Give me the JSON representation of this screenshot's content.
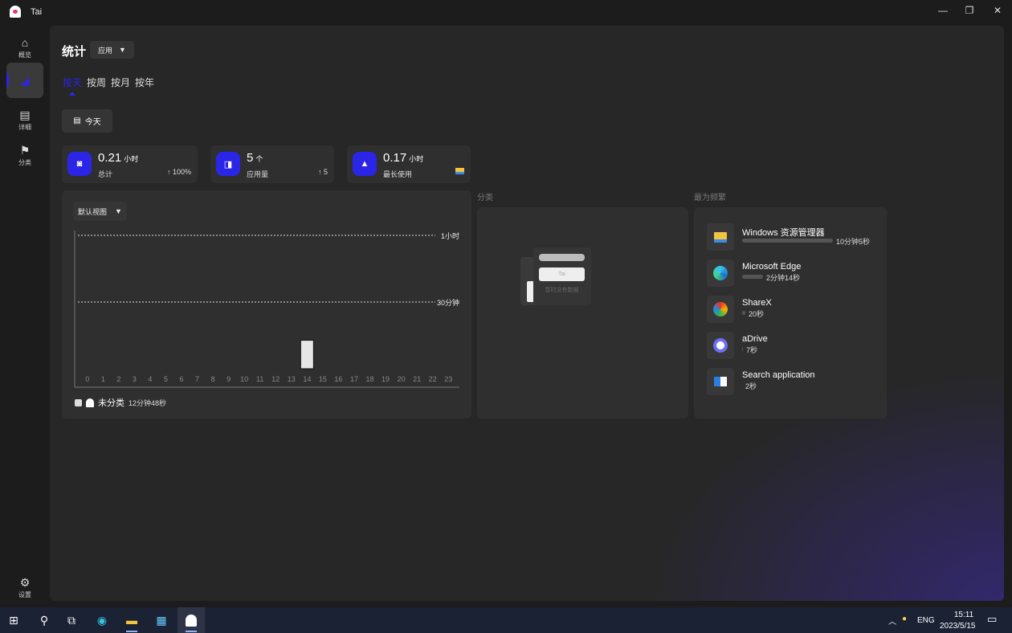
{
  "window": {
    "title": "Tai",
    "controls": [
      "—",
      "❐",
      "✕"
    ]
  },
  "sidebar": {
    "items": [
      {
        "label": "概览",
        "icon": "⌂"
      },
      {
        "label": "",
        "icon": "◢"
      },
      {
        "label": "详细",
        "icon": "▤"
      },
      {
        "label": "分类",
        "icon": "⚑"
      }
    ],
    "settings": {
      "label": "设置",
      "icon": "⚙"
    }
  },
  "header": {
    "title": "统计",
    "filter": "应用"
  },
  "tabs": [
    "按天",
    "按周",
    "按月",
    "按年"
  ],
  "date_button": "今天",
  "stats": [
    {
      "value": "0.21",
      "unit": "小时",
      "label": "总计",
      "change": "↑ 100%"
    },
    {
      "value": "5",
      "unit": "个",
      "label": "应用量",
      "change": "↑ 5"
    },
    {
      "value": "0.17",
      "unit": "小时",
      "label": "最长使用",
      "change": ""
    }
  ],
  "chart": {
    "view_select": "默认视图",
    "legend_label": "未分类",
    "legend_value": "12分钟48秒"
  },
  "chart_data": {
    "type": "bar",
    "categories": [
      "0",
      "1",
      "2",
      "3",
      "4",
      "5",
      "6",
      "7",
      "8",
      "9",
      "10",
      "11",
      "12",
      "13",
      "14",
      "15",
      "16",
      "17",
      "18",
      "19",
      "20",
      "21",
      "22",
      "23"
    ],
    "series": [
      {
        "name": "未分类",
        "values": [
          0,
          0,
          0,
          0,
          0,
          0,
          0,
          0,
          0,
          0,
          0,
          0,
          0,
          0,
          12.8,
          0,
          0,
          0,
          0,
          0,
          0,
          0,
          0,
          0
        ]
      }
    ],
    "ylim": [
      0,
      60
    ],
    "yticks": [
      {
        "value": 30,
        "label": "30分钟"
      },
      {
        "value": 60,
        "label": "1小时"
      }
    ],
    "grid": "dashed",
    "accent": "#2b25e8"
  },
  "category": {
    "title": "分类",
    "empty_tag": "Tai",
    "empty_text": "暂时没有数据"
  },
  "frequent": {
    "title": "最为频繁",
    "items": [
      {
        "name": "Windows 资源管理器",
        "time": "10分钟5秒",
        "share": 0.79,
        "icon": "folder-icon"
      },
      {
        "name": "Microsoft Edge",
        "time": "2分钟14秒",
        "share": 0.18,
        "icon": "edge-icon"
      },
      {
        "name": "ShareX",
        "time": "20秒",
        "share": 0.03,
        "icon": "sharex-icon"
      },
      {
        "name": "aDrive",
        "time": "7秒",
        "share": 0.01,
        "icon": "adrive-icon"
      },
      {
        "name": "Search application",
        "time": "2秒",
        "share": 0.0,
        "icon": "search-app-icon"
      }
    ]
  },
  "taskbar": {
    "lang": "ENG",
    "time": "15:11",
    "date": "2023/5/15"
  }
}
